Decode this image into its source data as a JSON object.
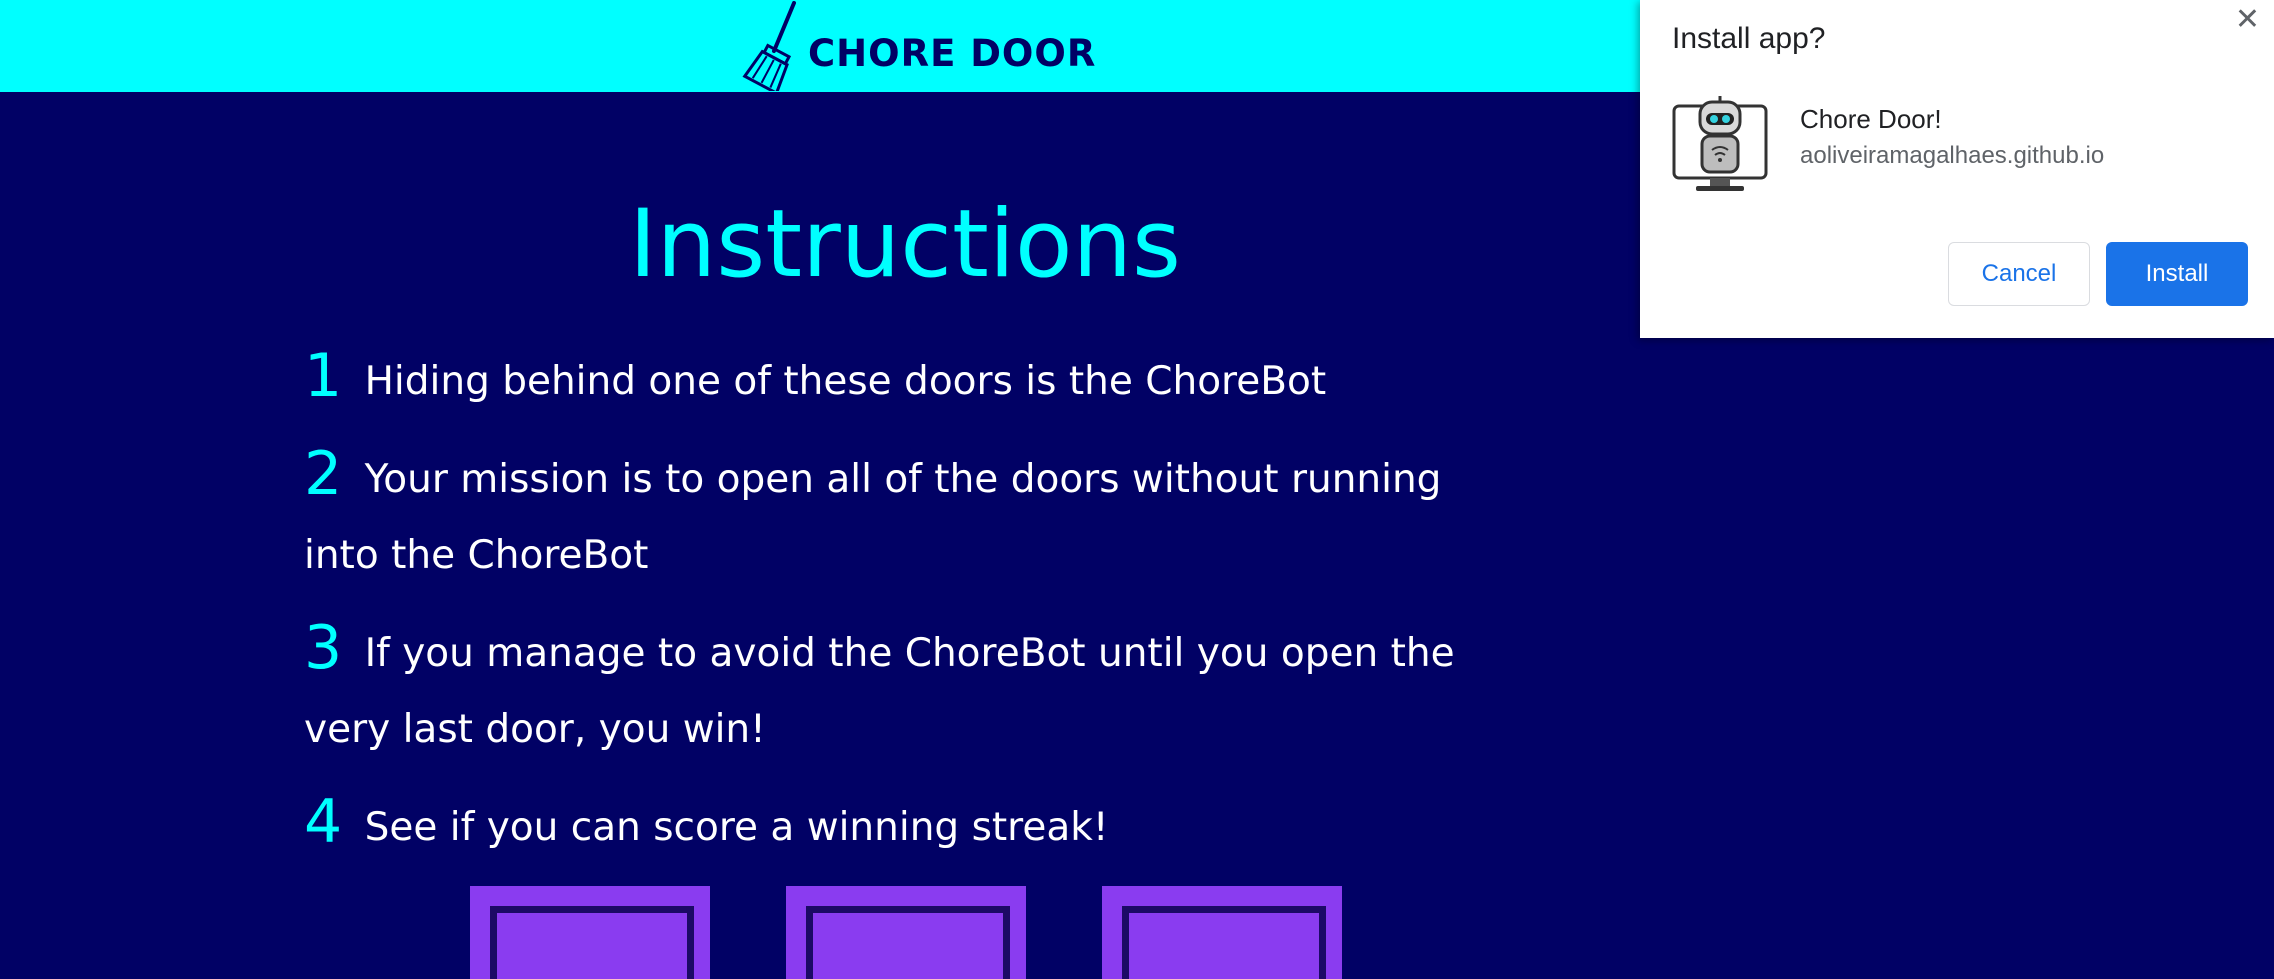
{
  "header": {
    "logo_text": "CHORE DOOR",
    "logo_icon": "broom-icon",
    "background": "#00ffff"
  },
  "main": {
    "title": "Instructions",
    "instructions": [
      {
        "number": "1",
        "text": "Hiding behind one of these doors is the ChoreBot"
      },
      {
        "number": "2",
        "text": "Your mission is to open all of the doors without running into the ChoreBot"
      },
      {
        "number": "3",
        "text": "If you manage to avoid the ChoreBot until you open the very last door, you win!"
      },
      {
        "number": "4",
        "text": "See if you can score a winning streak!"
      }
    ],
    "doors": [
      "door-1",
      "door-2",
      "door-3"
    ],
    "background": "#010165",
    "accent": "#00ffff",
    "door_color": "#8a3cf0"
  },
  "install_dialog": {
    "title": "Install app?",
    "close_icon": "close-icon",
    "app_icon": "robot-icon",
    "app_name": "Chore Door!",
    "app_url": "aoliveiramagalhaes.github.io",
    "cancel_label": "Cancel",
    "install_label": "Install",
    "primary_color": "#1a73e8"
  }
}
